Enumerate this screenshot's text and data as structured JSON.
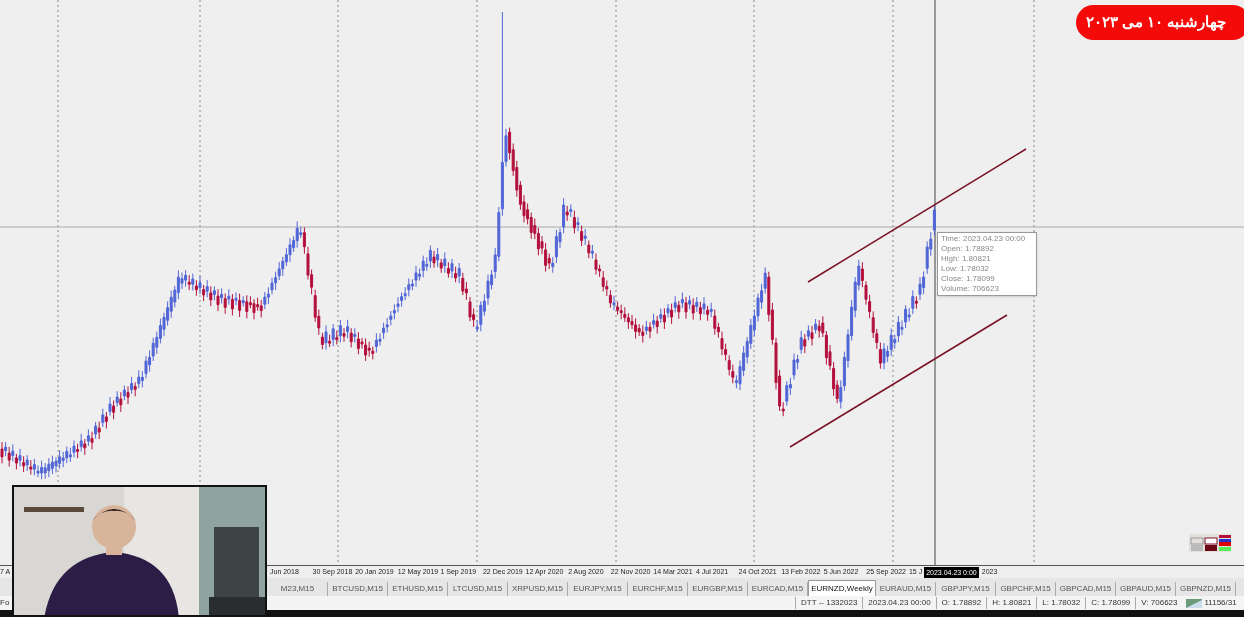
{
  "date_badge": "چهارشنبه  ۱۰ می ۲۰۲۳",
  "tooltip": [
    "Time: 2023.04.23 00:00",
    "Open: 1.78892",
    "High: 1.80821",
    "Low: 1.78032",
    "Close: 1.78099",
    "Volume: 706623"
  ],
  "axis_left_cut": "7 A",
  "axis_labels": [
    "Jun 2018",
    "30 Sep 2018",
    "20 Jan 2019",
    "12 May 2019",
    "1 Sep 2019",
    "22 Dec 2019",
    "12 Apr 2020",
    "2 Aug 2020",
    "22 Nov 2020",
    "14 Mar 2021",
    "4 Jul 2021",
    "24 Oct 2021",
    "13 Feb 2022",
    "5 Jun 2022",
    "25 Sep 2022",
    "15 J"
  ],
  "cursor_label": "2023.04.23 0:00",
  "axis_tail": "2023",
  "tabs": [
    {
      "label": "M23,M15",
      "selected": false
    },
    {
      "label": "BTCUSD,M15",
      "selected": false
    },
    {
      "label": "ETHUSD,M15",
      "selected": false
    },
    {
      "label": "LTCUSD,M15",
      "selected": false
    },
    {
      "label": "XRPUSD,M15",
      "selected": false
    },
    {
      "label": "EURJPY,M15",
      "selected": false
    },
    {
      "label": "EURCHF,M15",
      "selected": false
    },
    {
      "label": "EURGBP,M15",
      "selected": false
    },
    {
      "label": "EURCAD,M15",
      "selected": false
    },
    {
      "label": "EURNZD,Weekly",
      "selected": true
    },
    {
      "label": "EURAUD,M15",
      "selected": false
    },
    {
      "label": "GBPJPY,M15",
      "selected": false
    },
    {
      "label": "GBPCHF,M15",
      "selected": false
    },
    {
      "label": "GBPCAD,M15",
      "selected": false
    },
    {
      "label": "GBPAUD,M15",
      "selected": false
    },
    {
      "label": "GBPNZD,M15",
      "selected": false
    }
  ],
  "status_bar": {
    "left_cut": "Fo",
    "fields": [
      "DTT -- 1332023",
      "2023.04.23 00:00",
      "O: 1.78892",
      "H: 1.80821",
      "L: 1.78032",
      "C: 1.78099",
      "V: 706623"
    ],
    "traffic": "11156/31"
  },
  "video_overlay": {
    "kind": "picture"
  }
}
